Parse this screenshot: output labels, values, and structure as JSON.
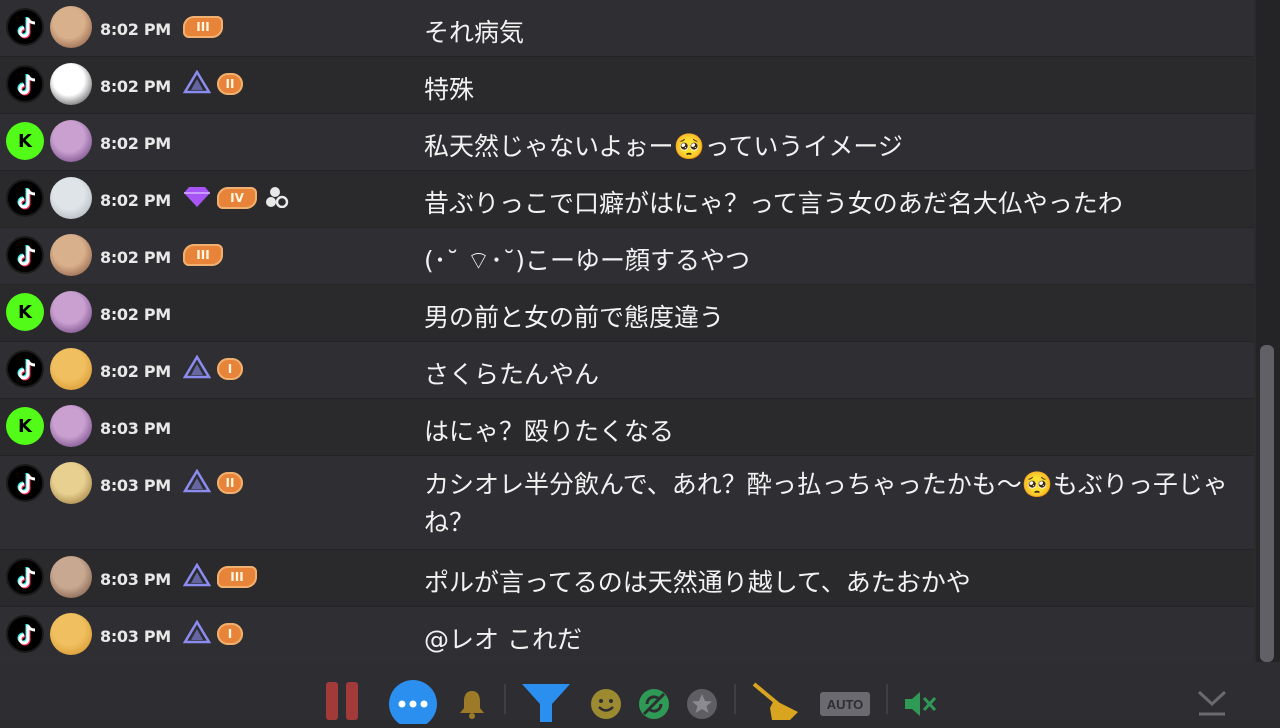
{
  "messages": [
    {
      "platform": "tiktok",
      "time": "8:02 PM",
      "badges": [
        {
          "type": "level-wing",
          "text": "III"
        }
      ],
      "text": "それ病気"
    },
    {
      "platform": "tiktok",
      "time": "8:02 PM",
      "badges": [
        {
          "type": "triangle"
        },
        {
          "type": "level",
          "text": "II"
        }
      ],
      "text": "特殊"
    },
    {
      "platform": "kick",
      "time": "8:02 PM",
      "badges": [],
      "text": "私天然じゃないよぉー🥺っていうイメージ"
    },
    {
      "platform": "tiktok",
      "time": "8:02 PM",
      "badges": [
        {
          "type": "diamond"
        },
        {
          "type": "level-wing",
          "text": "IV"
        },
        {
          "type": "mod"
        }
      ],
      "text": "昔ぶりっこで口癖がはにゃ？って言う女のあだ名大仏やったわ"
    },
    {
      "platform": "tiktok",
      "time": "8:02 PM",
      "badges": [
        {
          "type": "level-wing",
          "text": "III"
        }
      ],
      "text": "(･˘ ⌔･˘)こーゆー顔するやつ"
    },
    {
      "platform": "kick",
      "time": "8:02 PM",
      "badges": [],
      "text": "男の前と女の前で態度違う"
    },
    {
      "platform": "tiktok",
      "time": "8:02 PM",
      "badges": [
        {
          "type": "triangle"
        },
        {
          "type": "level",
          "text": "I"
        }
      ],
      "text": "さくらたんやん"
    },
    {
      "platform": "kick",
      "time": "8:03 PM",
      "badges": [],
      "text": "はにゃ？殴りたくなる"
    },
    {
      "platform": "tiktok",
      "time": "8:03 PM",
      "badges": [
        {
          "type": "triangle"
        },
        {
          "type": "level",
          "text": "II"
        }
      ],
      "text": "カシオレ半分飲んで、あれ？酔っ払っちゃったかも〜🥺もぶりっ子じゃね？"
    },
    {
      "platform": "tiktok",
      "time": "8:03 PM",
      "badges": [
        {
          "type": "triangle"
        },
        {
          "type": "level-wing",
          "text": "III"
        }
      ],
      "text": "ポルが言ってるのは天然通り越して、あたおかや"
    },
    {
      "platform": "tiktok",
      "time": "8:03 PM",
      "badges": [
        {
          "type": "triangle"
        },
        {
          "type": "level",
          "text": "I"
        }
      ],
      "text": "@レオ これだ"
    }
  ],
  "toolbar": {
    "pause_icon": "pause-icon",
    "more_icon": "more-dots-icon",
    "bell_icon": "bell-icon",
    "filter_icon": "filter-icon",
    "emoji_icon": "emoji-icon",
    "sync_icon": "sync-icon",
    "star_icon": "star-icon",
    "broom_icon": "broom-icon",
    "auto_label": "AUTO",
    "mute_icon": "speaker-mute-icon",
    "scroll_down_icon": "scroll-down-icon"
  },
  "colors": {
    "background": "#2b2b2e",
    "text": "#f2f2f2",
    "kick": "#53fc18",
    "level_badge": "#e8843a",
    "triangle_badge": "#8c8cf0",
    "diamond_badge": "#a855f7",
    "pause": "#a33a3a",
    "more": "#2b8ff0",
    "filter": "#2b8ff0"
  }
}
